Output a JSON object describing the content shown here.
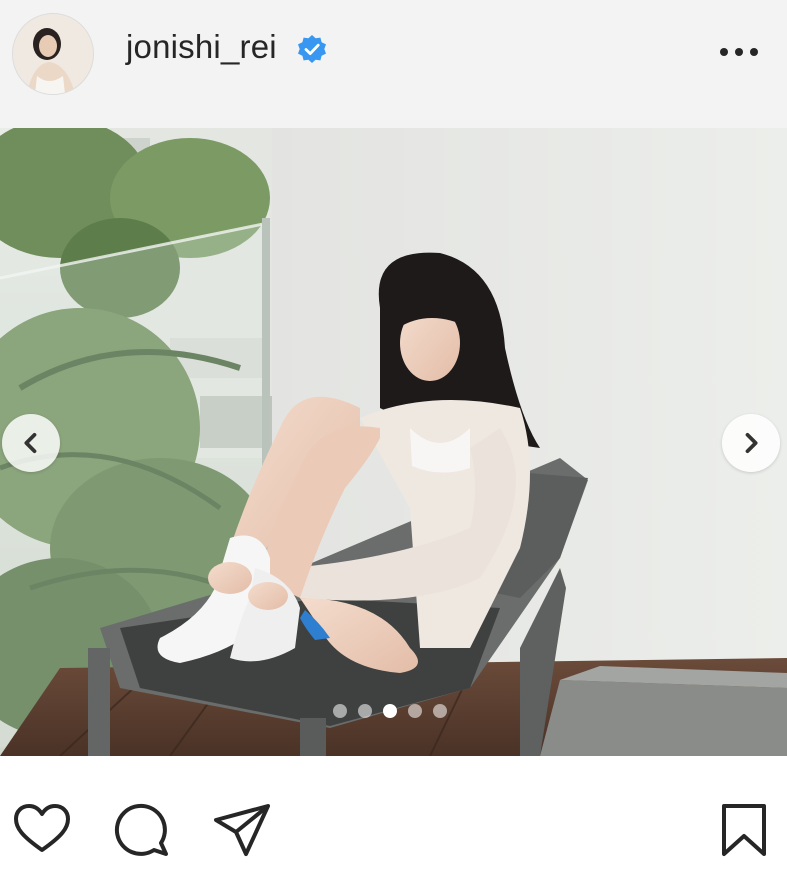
{
  "post": {
    "username": "jonishi_rei",
    "verified": true,
    "carousel": {
      "total_slides": 5,
      "active_slide": 3
    }
  },
  "icons": {
    "verified": "verified-badge-icon",
    "more": "more-options-icon",
    "prev": "chevron-left-icon",
    "next": "chevron-right-icon",
    "like": "heart-icon",
    "comment": "comment-icon",
    "share": "send-icon",
    "save": "bookmark-icon"
  },
  "colors": {
    "header_bg": "#f3f3f3",
    "text": "#262626",
    "verified_blue": "#3897f0"
  }
}
